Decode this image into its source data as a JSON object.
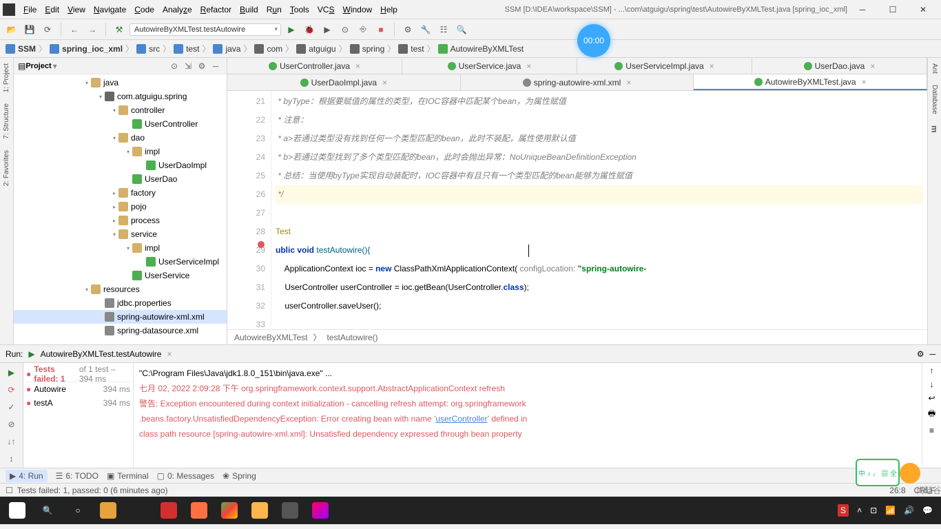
{
  "menu": {
    "items": [
      "File",
      "Edit",
      "View",
      "Navigate",
      "Code",
      "Analyze",
      "Refactor",
      "Build",
      "Run",
      "Tools",
      "VCS",
      "Window",
      "Help"
    ],
    "title": "SSM [D:\\IDEA\\workspace\\SSM] - ...\\com\\atguigu\\spring\\test\\AutowireByXMLTest.java [spring_ioc_xml]"
  },
  "runcfg": "AutowireByXMLTest.testAutowire",
  "timer": "00:00",
  "breadcrumbs": [
    "SSM",
    "spring_ioc_xml",
    "src",
    "test",
    "java",
    "com",
    "atguigu",
    "spring",
    "test",
    "AutowireByXMLTest"
  ],
  "project": {
    "title": "Project",
    "nodes": [
      {
        "pad": 100,
        "arrow": "▾",
        "icon": "fold",
        "label": "java"
      },
      {
        "pad": 120,
        "arrow": "▾",
        "icon": "ic-pkg",
        "label": "com.atguigu.spring"
      },
      {
        "pad": 140,
        "arrow": "▾",
        "icon": "fold",
        "label": "controller"
      },
      {
        "pad": 160,
        "arrow": "",
        "icon": "ic-cls",
        "label": "UserController"
      },
      {
        "pad": 140,
        "arrow": "▾",
        "icon": "fold",
        "label": "dao"
      },
      {
        "pad": 160,
        "arrow": "▾",
        "icon": "fold",
        "label": "impl"
      },
      {
        "pad": 180,
        "arrow": "",
        "icon": "ic-cls",
        "label": "UserDaoImpl"
      },
      {
        "pad": 160,
        "arrow": "",
        "icon": "ic-int",
        "label": "UserDao"
      },
      {
        "pad": 140,
        "arrow": "▸",
        "icon": "fold",
        "label": "factory"
      },
      {
        "pad": 140,
        "arrow": "▸",
        "icon": "fold",
        "label": "pojo"
      },
      {
        "pad": 140,
        "arrow": "▸",
        "icon": "fold",
        "label": "process"
      },
      {
        "pad": 140,
        "arrow": "▾",
        "icon": "fold",
        "label": "service"
      },
      {
        "pad": 160,
        "arrow": "▾",
        "icon": "fold",
        "label": "impl"
      },
      {
        "pad": 180,
        "arrow": "",
        "icon": "ic-cls",
        "label": "UserServiceImpl"
      },
      {
        "pad": 160,
        "arrow": "",
        "icon": "ic-int",
        "label": "UserService"
      },
      {
        "pad": 100,
        "arrow": "▾",
        "icon": "fold",
        "label": "resources"
      },
      {
        "pad": 120,
        "arrow": "",
        "icon": "ic-file",
        "label": "jdbc.properties"
      },
      {
        "pad": 120,
        "arrow": "",
        "icon": "ic-xml",
        "label": "spring-autowire-xml.xml",
        "sel": true
      },
      {
        "pad": 120,
        "arrow": "",
        "icon": "ic-xml",
        "label": "spring-datasource.xml"
      }
    ]
  },
  "tabs1": [
    {
      "label": "UserController.java",
      "icon": "ic-cls"
    },
    {
      "label": "UserService.java",
      "icon": "ic-int"
    },
    {
      "label": "UserServiceImpl.java",
      "icon": "ic-cls"
    },
    {
      "label": "UserDao.java",
      "icon": "ic-int"
    }
  ],
  "tabs2": [
    {
      "label": "UserDaoImpl.java",
      "icon": "ic-cls"
    },
    {
      "label": "spring-autowire-xml.xml",
      "icon": "ic-xml"
    },
    {
      "label": "AutowireByXMLTest.java",
      "icon": "ic-cls",
      "active": true
    }
  ],
  "gutter": [
    "21",
    "22",
    "23",
    "24",
    "25",
    "26",
    "27",
    "28",
    "29",
    "30",
    "31",
    "32",
    "33"
  ],
  "code": {
    "l21": " * byType：根据要赋值的属性的类型，在IOC容器中匹配某个bean，为属性赋值",
    "l22": " * 注意：",
    "l23": " * a>若通过类型没有找到任何一个类型匹配的bean，此时不装配，属性使用默认值",
    "l24": " * b>若通过类型找到了多个类型匹配的bean，此时会抛出异常：NoUniqueBeanDefinitionException",
    "l25": " * 总结：当使用byType实现自动装配时，IOC容器中有且只有一个类型匹配的bean能够为属性赋值",
    "l26": " */",
    "l28": "Test",
    "l29a": "ublic ",
    "l29b": "void ",
    "l29c": "testAutowire(){",
    "l30a": "    ApplicationContext ioc = ",
    "l30b": "new ",
    "l30c": "ClassPathXmlApplicationContext(",
    "l30d": " configLocation: ",
    "l30e": "\"spring-autowire-",
    "l31a": "    UserController userController = ioc.getBean(UserController.",
    "l31b": "class",
    "l31c": ");",
    "l32": "    userController.saveUser();"
  },
  "codebread": [
    "AutowireByXMLTest",
    "testAutowire()"
  ],
  "run": {
    "label": "Run:",
    "config": "AutowireByXMLTest.testAutowire",
    "status": "Tests failed: 1",
    "status2": " of 1 test – 394 ms",
    "items": [
      {
        "label": "Autowire",
        "time": "394 ms",
        "fail": true
      },
      {
        "label": "testA",
        "time": "394 ms",
        "fail": true
      }
    ],
    "console": {
      "l1": "\"C:\\Program Files\\Java\\jdk1.8.0_151\\bin\\java.exe\" ...",
      "l2": "七月 02, 2022 2:09:28 下午 org.springframework.context.support.AbstractApplicationContext refresh",
      "l3a": "警告: Exception encountered during context initialization - cancelling refresh attempt: org.springframework",
      "l3b": ".beans.factory.UnsatisfiedDependencyException: Error creating bean with name '",
      "l3c": "userController",
      "l3d": "' defined in ",
      "l4": "class path resource [spring-autowire-xml.xml]: Unsatisfied dependency expressed through bean property "
    }
  },
  "bottom": {
    "items": [
      "4: Run",
      "6: TODO",
      "Terminal",
      "0: Messages",
      "Spring"
    ]
  },
  "status": {
    "msg": "Tests failed: 1, passed: 0 (6 minutes ago)",
    "pos": "26:8",
    "enc": "CRLF"
  },
  "ime": "中 ♪\n♩ ▦ 全"
}
